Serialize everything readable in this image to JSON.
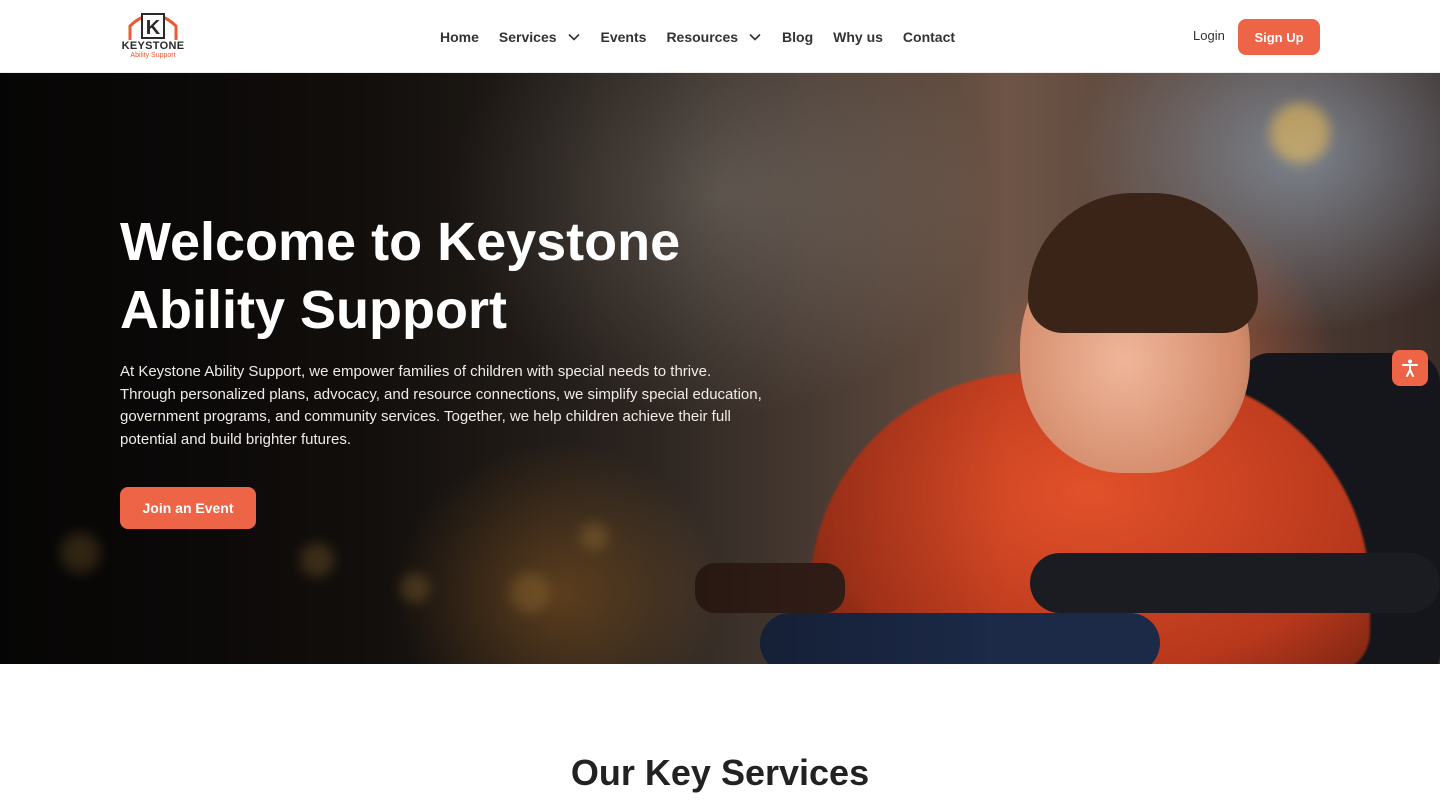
{
  "brand": {
    "name": "KEYSTONE",
    "tagline": "Ability Support",
    "logo_letter": "K",
    "accent": "#ee6446"
  },
  "nav": {
    "items": [
      {
        "label": "Home",
        "dropdown": false
      },
      {
        "label": "Services",
        "dropdown": true
      },
      {
        "label": "Events",
        "dropdown": false
      },
      {
        "label": "Resources",
        "dropdown": true
      },
      {
        "label": "Blog",
        "dropdown": false
      },
      {
        "label": "Why us",
        "dropdown": false
      },
      {
        "label": "Contact",
        "dropdown": false
      }
    ],
    "login_label": "Login",
    "signup_label": "Sign Up"
  },
  "hero": {
    "title": "Welcome to Keystone Ability Support",
    "body": "At Keystone Ability Support, we empower families of children with special needs to thrive. Through personalized plans, advocacy, and resource connections, we simplify special education, government programs, and community services. Together, we help children achieve their full potential and build brighter futures.",
    "cta_label": "Join an Event"
  },
  "accessibility": {
    "icon": "accessibility-icon"
  },
  "services": {
    "heading": "Our Key Services"
  }
}
